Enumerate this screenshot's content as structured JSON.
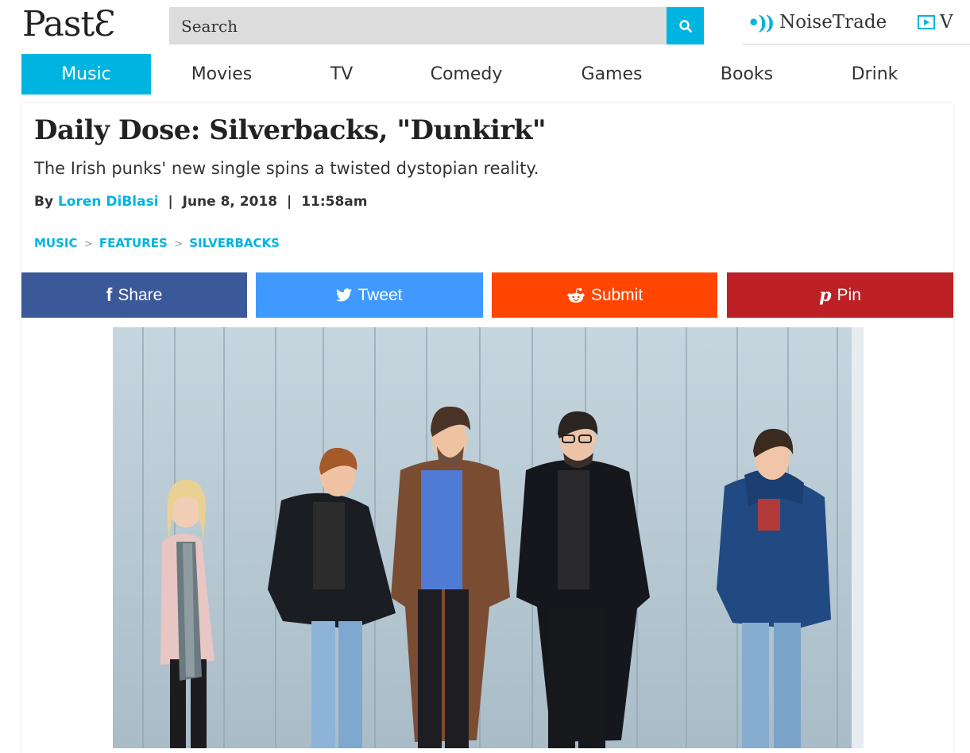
{
  "header": {
    "logo": "PastƐ",
    "search_placeholder": "Search",
    "noisetrade_label": "NoiseTrade",
    "video_label": "V"
  },
  "nav": {
    "items": [
      {
        "label": "Music",
        "active": true
      },
      {
        "label": "Movies"
      },
      {
        "label": "TV"
      },
      {
        "label": "Comedy"
      },
      {
        "label": "Games"
      },
      {
        "label": "Books"
      },
      {
        "label": "Drink"
      }
    ]
  },
  "article": {
    "title": "Daily Dose: Silverbacks, \"Dunkirk\"",
    "dek": "The Irish punks' new single spins a twisted dystopian reality.",
    "byline_prefix": "By",
    "author": "Loren DiBlasi",
    "separator": "|",
    "date": "June 8, 2018",
    "time": "11:58am",
    "breadcrumbs": [
      "MUSIC",
      "FEATURES",
      "SILVERBACKS"
    ],
    "breadcrumb_separator": ">"
  },
  "share": {
    "facebook_label": "Share",
    "twitter_label": "Tweet",
    "reddit_label": "Submit",
    "pinterest_label": "Pin"
  },
  "colors": {
    "accent": "#00b4e1",
    "facebook": "#3b5998",
    "twitter": "#4099ff",
    "reddit": "#ff4500",
    "pinterest": "#bd2125"
  }
}
